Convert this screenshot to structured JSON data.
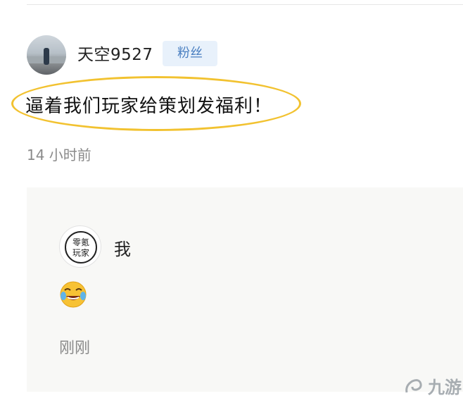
{
  "comment": {
    "username": "天空9527",
    "badge": "粉丝",
    "text": "逼着我们玩家给策划发福利！",
    "timestamp": "14 小时前"
  },
  "reply": {
    "avatar_text": "零氪玩家",
    "username": "我",
    "emoji_icon": "laughing-crying-emoji",
    "timestamp": "刚刚"
  },
  "watermark": {
    "text": "九游"
  },
  "colors": {
    "highlight": "#f2c230",
    "badge_bg": "#e8f1fb",
    "badge_text": "#4a7fc1"
  }
}
